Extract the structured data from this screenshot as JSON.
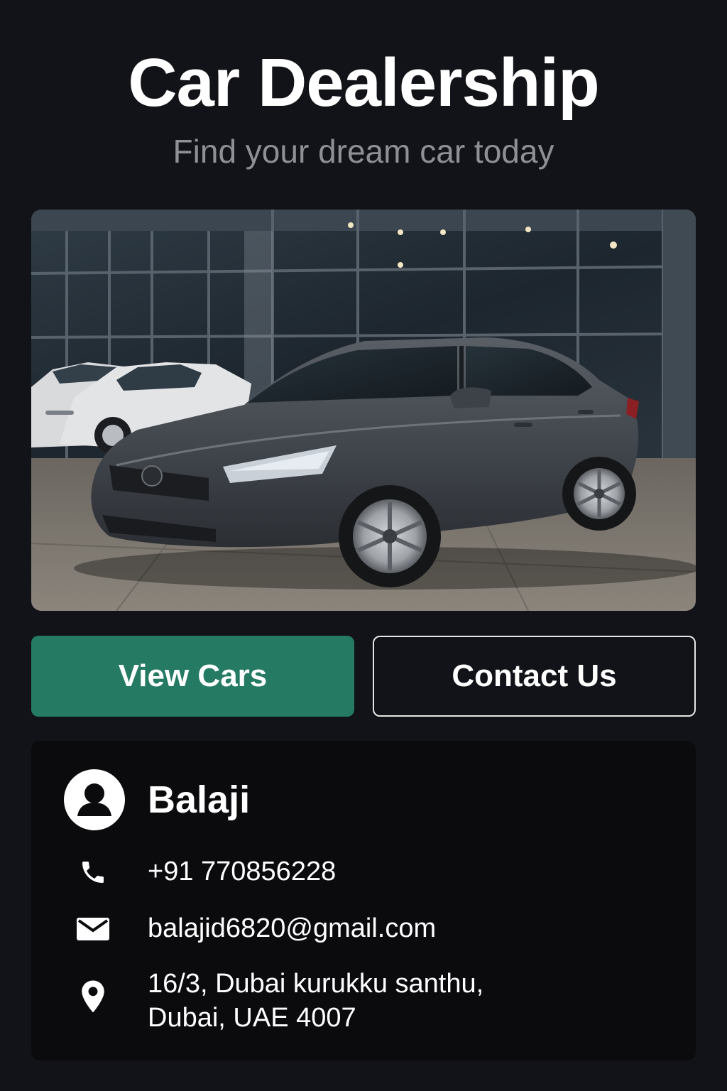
{
  "header": {
    "title": "Car Dealership",
    "subtitle": "Find your dream car today"
  },
  "hero": {
    "image": "dark-gray-sedan-at-dealership"
  },
  "actions": {
    "primary_label": "View Cars",
    "secondary_label": "Contact Us"
  },
  "contact": {
    "name": "Balaji",
    "phone": "+91 770856228",
    "email": "balajid6820@gmail.com",
    "address_line1": "16/3, Dubai kurukku santhu,",
    "address_line2": "Dubai, UAE 4007",
    "icons": [
      "user-avatar-icon",
      "phone-icon",
      "mail-icon",
      "location-pin-icon"
    ]
  },
  "colors": {
    "background": "#121318",
    "accent": "#257a63",
    "card": "#0b0b0e",
    "subtitle": "#8e9096"
  }
}
